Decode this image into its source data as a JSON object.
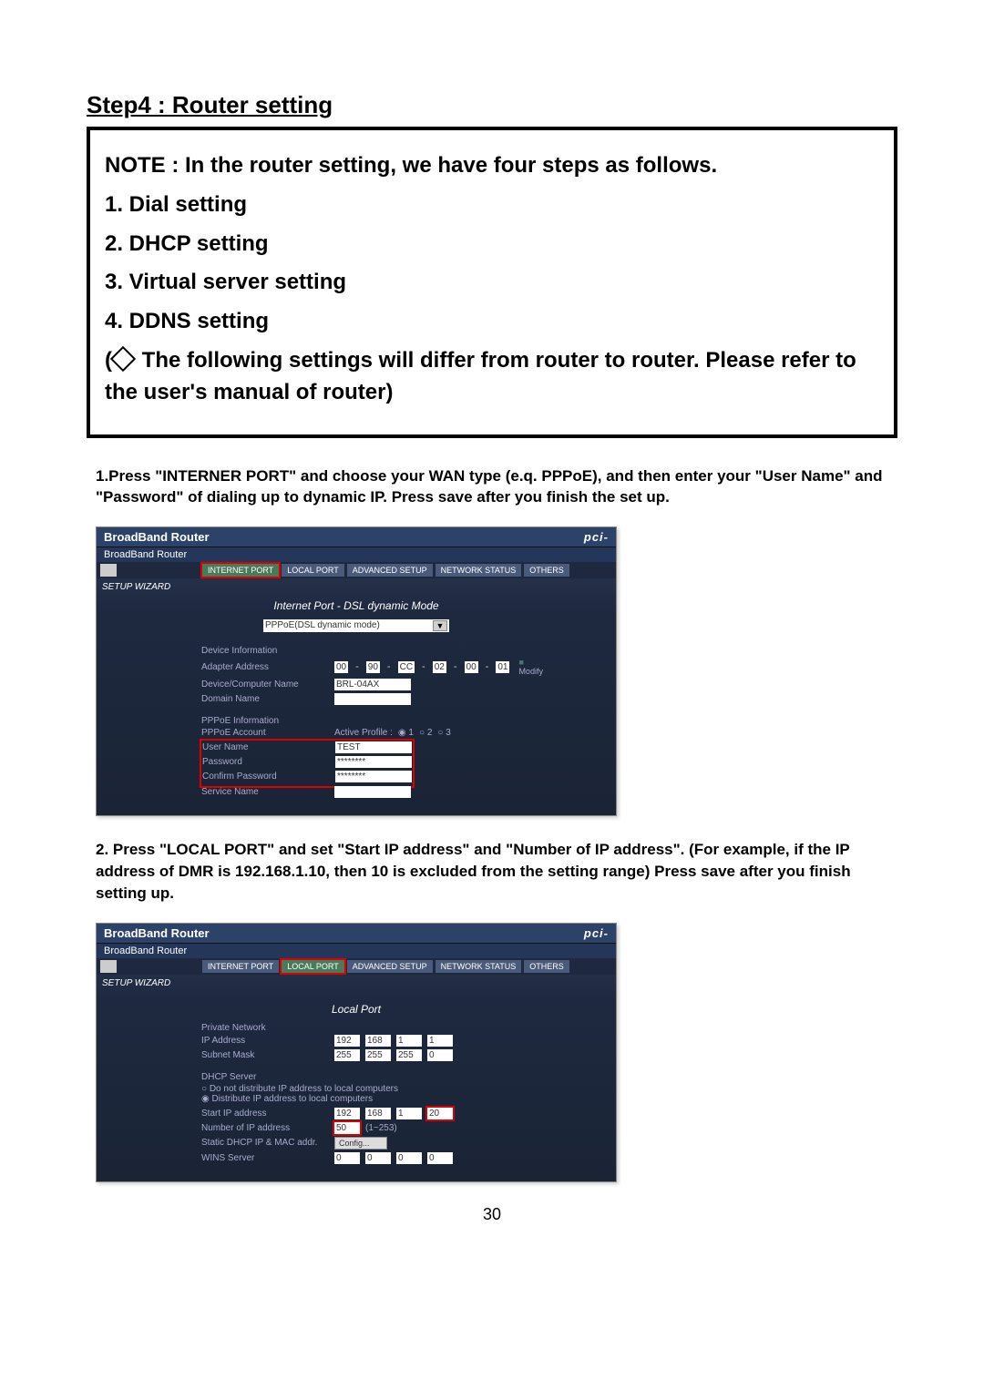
{
  "step_title": "Step4 : Router setting",
  "note": {
    "intro": "NOTE : In the router setting, we have four steps as follows.",
    "items": [
      "1. Dial setting",
      "2. DHCP setting",
      "3. Virtual server setting",
      "4. DDNS setting"
    ],
    "footer": "The following settings will differ from router to router. Please refer to the user's manual of router)"
  },
  "instruction1": "1.Press \"INTERNER PORT\" and choose your WAN type (e.q. PPPoE), and then enter your  \"User Name\" and \"Password\" of dialing up to dynamic IP. Press save after you finish the set up.",
  "instruction2": "2. Press \"LOCAL PORT\" and set \"Start IP address\" and \"Number of IP address\". (For example, if the IP address of DMR is 192.168.1.10, then 10 is excluded from the setting range) Press  save after you finish setting up.",
  "screenshot1": {
    "window_title": "BroadBand Router",
    "brand": "pci-",
    "subtitle1": "BroadBand Router",
    "subtitle2": "BroadBand Router",
    "tabs": [
      "INTERNET PORT",
      "LOCAL PORT",
      "ADVANCED SETUP",
      "NETWORK STATUS",
      "OTHERS"
    ],
    "wizard": "SETUP WIZARD",
    "heading": "Internet Port - DSL dynamic Mode",
    "select_value": "PPPoE(DSL dynamic mode)",
    "sections": {
      "device_info": "Device Information",
      "adapter_addr": "Adapter Address",
      "adapter_octets": [
        "00",
        "90",
        "CC",
        "02",
        "00",
        "01"
      ],
      "modify": "Modify",
      "device_name_label": "Device/Computer Name",
      "device_name_value": "BRL-04AX",
      "domain_name_label": "Domain Name",
      "pppoe_info": "PPPoE Information",
      "pppoe_account": "PPPoE Account",
      "active_profile": "Active Profile :",
      "user_name_label": "User Name",
      "user_name_value": "TEST",
      "password_label": "Password",
      "password_value": "********",
      "confirm_label": "Confirm Password",
      "confirm_value": "********",
      "service_label": "Service Name"
    }
  },
  "screenshot2": {
    "window_title": "BroadBand Router",
    "brand": "pci-",
    "subtitle1": "BroadBand Router",
    "subtitle2": "BroadBand Router",
    "tabs": [
      "INTERNET PORT",
      "LOCAL PORT",
      "ADVANCED SETUP",
      "NETWORK STATUS",
      "OTHERS"
    ],
    "wizard": "SETUP WIZARD",
    "heading": "Local Port",
    "sections": {
      "private_net": "Private Network",
      "ip_addr_label": "IP Address",
      "ip_addr": [
        "192",
        "168",
        "1",
        "1"
      ],
      "subnet_label": "Subnet Mask",
      "subnet": [
        "255",
        "255",
        "255",
        "0"
      ],
      "dhcp_server": "DHCP Server",
      "opt1": "Do not distribute IP address to local computers",
      "opt2": "Distribute IP address to local computers",
      "start_ip_label": "Start IP address",
      "start_ip": [
        "192",
        "168",
        "1",
        "20"
      ],
      "num_ip_label": "Number of IP address",
      "num_ip_value": "50",
      "num_ip_range": "(1~253)",
      "static_label": "Static DHCP IP & MAC addr.",
      "config_btn": "Config...",
      "wins_label": "WINS Server",
      "wins": [
        "0",
        "0",
        "0",
        "0"
      ]
    }
  },
  "page_number": "30"
}
